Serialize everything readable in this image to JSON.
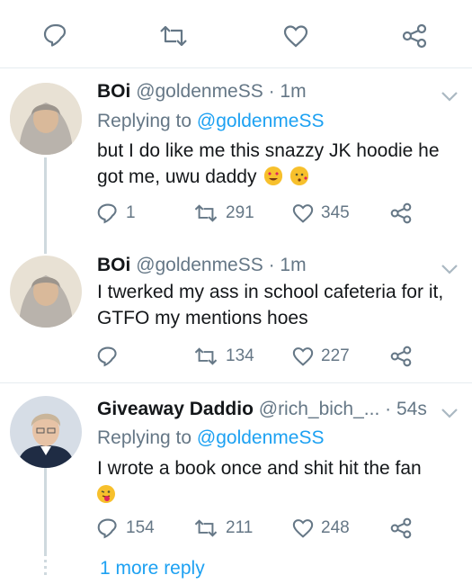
{
  "top_actions": [
    "reply-icon",
    "retweet-icon",
    "like-icon",
    "share-icon"
  ],
  "tweets": [
    {
      "name": "BOi",
      "handle": "@goldenmeSS",
      "time": "· 1m",
      "replying_prefix": "Replying to",
      "replying_to": "@goldenmeSS",
      "text": "but I do like me this snazzy JK hoodie he got me, uwu daddy",
      "emojis": [
        "heart-eyes-emoji",
        "kissing-face-emoji"
      ],
      "replies": "1",
      "retweets": "291",
      "likes": "345"
    },
    {
      "name": "BOi",
      "handle": "@goldenmeSS",
      "time": "· 1m",
      "text": "I twerked my ass in school cafeteria for it, GTFO my mentions hoes",
      "replies": "",
      "retweets": "134",
      "likes": "227"
    },
    {
      "name": "Giveaway Daddio",
      "handle": "@rich_bich_...",
      "time": "· 54s",
      "replying_prefix": "Replying to",
      "replying_to": "@goldenmeSS",
      "text": "I wrote a book once and shit hit the fan",
      "emojis": [
        "tongue-out-emoji"
      ],
      "replies": "154",
      "retweets": "211",
      "likes": "248"
    }
  ],
  "more_reply_label": "1 more reply",
  "colors": {
    "accent": "#1da1f2",
    "muted": "#657786",
    "divider": "#e6ecf0"
  }
}
